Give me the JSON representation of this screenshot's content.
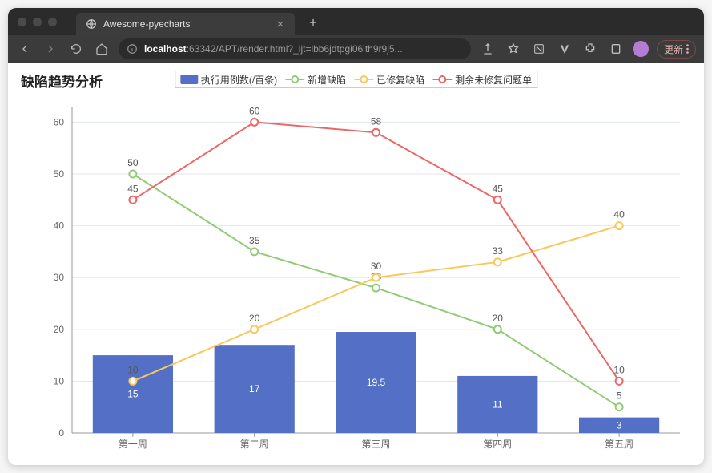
{
  "browser": {
    "tab_title": "Awesome-pyecharts",
    "url_host": "localhost",
    "url_port": ":63342",
    "url_path": "/APT/render.html?_ijt=lbb6jdtpgi06ith9r9j5...",
    "update_label": "更新"
  },
  "chart_title": "缺陷趋势分析",
  "legend": {
    "bar": "执行用例数(/百条)",
    "line1": "新增缺陷",
    "line2": "已修复缺陷",
    "line3": "剩余未修复问题单"
  },
  "colors": {
    "bar": "#5470c6",
    "line_new": "#91cc75",
    "line_fixed": "#fac858",
    "line_remain": "#ee6666",
    "axis": "#666",
    "grid": "#e0e6f1"
  },
  "chart_data": {
    "type": "bar+line",
    "categories": [
      "第一周",
      "第二周",
      "第三周",
      "第四周",
      "第五周"
    ],
    "y_ticks": [
      0,
      10,
      20,
      30,
      40,
      50,
      60
    ],
    "ylim": [
      0,
      63
    ],
    "series": [
      {
        "name": "执行用例数(/百条)",
        "type": "bar",
        "values": [
          15,
          17,
          19.5,
          11,
          3
        ],
        "color": "#5470c6"
      },
      {
        "name": "新增缺陷",
        "type": "line",
        "values": [
          50,
          35,
          28,
          20,
          5
        ],
        "color": "#91cc75"
      },
      {
        "name": "已修复缺陷",
        "type": "line",
        "values": [
          10,
          20,
          30,
          33,
          40
        ],
        "color": "#fac858"
      },
      {
        "name": "剩余未修复问题单",
        "type": "line",
        "values": [
          45,
          60,
          58,
          45,
          10
        ],
        "color": "#ee6666"
      }
    ],
    "title": "缺陷趋势分析",
    "xlabel": "",
    "ylabel": ""
  }
}
